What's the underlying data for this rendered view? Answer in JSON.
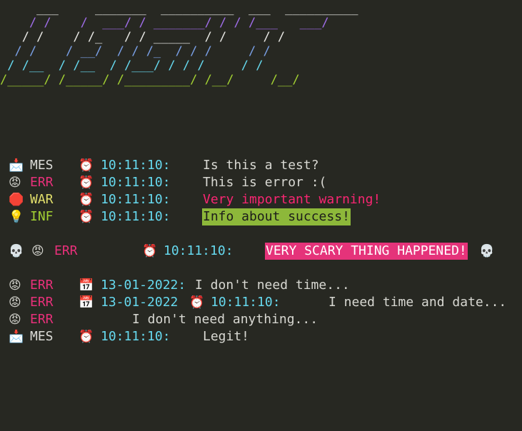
{
  "banner": {
    "lines": [
      "     ___     _______  __________  ___  __________",
      "    / /    /  ___/ / _______/ / / /___   ___/",
      "   / /    / /_   / / _____  / /     / /",
      "  / /    / __/  / / /_  / / /     / /",
      " / /__  / /__  / /___/ / / /     / /",
      "/_____/ /_____/ /_________/ /__/     /__/"
    ],
    "colors": [
      "#e8e8e4",
      "#9f6de8",
      "#e8e8e4",
      "#7aa0e6",
      "#66d9ef",
      "#a3d133"
    ]
  },
  "logs": [
    {
      "icon": "envelope-icon",
      "glyph": "📩",
      "level": "MES",
      "level_class": "lvl-mes",
      "clock": "⏰",
      "time": "10:11:10:",
      "message": "Is this a test?",
      "message_class": "msg"
    },
    {
      "icon": "angry-face-icon",
      "glyph": "😡",
      "level": "ERR",
      "level_class": "lvl-err",
      "clock": "⏰",
      "time": "10:11:10:",
      "message": "This is error :(",
      "message_class": "msg"
    },
    {
      "icon": "stop-sign-icon",
      "glyph": "🛑",
      "level": "WAR",
      "level_class": "lvl-war",
      "clock": "⏰",
      "time": "10:11:10:",
      "message": "Very important warning!",
      "message_class": "msg-warn"
    },
    {
      "icon": "light-bulb-icon",
      "glyph": "💡",
      "level": "INF",
      "level_class": "lvl-inf",
      "clock": "⏰",
      "time": "10:11:10:",
      "message": "Info about success!",
      "message_class": "msg-success"
    }
  ],
  "critical": {
    "skull": "💀",
    "face": "😡",
    "level": "ERR",
    "clock": "⏰",
    "time": "10:11:10:",
    "message": "VERY SCARY THING HAPPENED!",
    "skull_end": "💀"
  },
  "tail": [
    {
      "glyph": "😡",
      "level": "ERR",
      "calendar": "📅",
      "date": "13-01-2022:",
      "message": "I don't need time..."
    },
    {
      "glyph": "😡",
      "level": "ERR",
      "calendar": "📅",
      "date": "13-01-2022",
      "clock": "⏰",
      "time": "10:11:10:",
      "message": "I need time and date..."
    },
    {
      "glyph": "😡",
      "level": "ERR",
      "message": "I don't need anything..."
    },
    {
      "glyph": "📩",
      "level": "MES",
      "clock": "⏰",
      "time": "10:11:10:",
      "message": "Legit!"
    }
  ]
}
